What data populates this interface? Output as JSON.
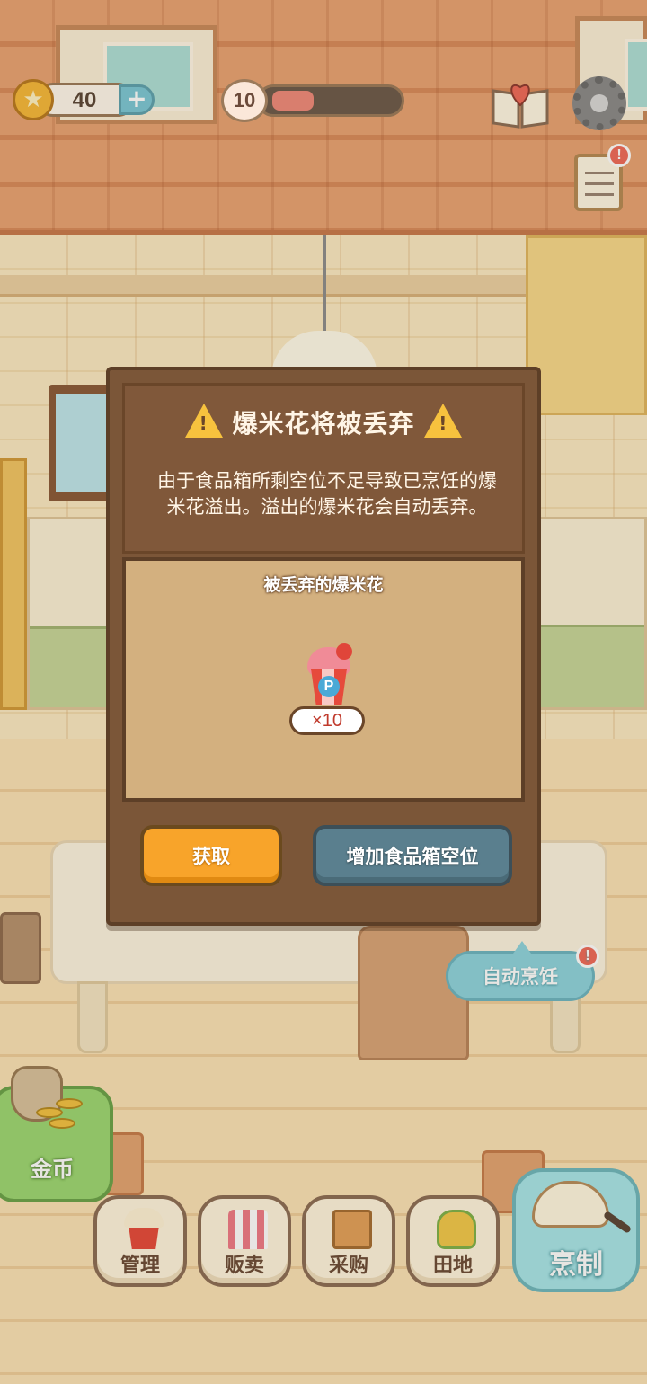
{
  "hud": {
    "coins": "40",
    "level": "10",
    "xp_progress": 0.28
  },
  "dialog": {
    "title": "爆米花将被丢弃",
    "warning_mark": "!",
    "description": "由于食品箱所剩空位不足导致已烹饪的爆米花溢出。溢出的爆米花会自动丢弃。",
    "discarded_label": "被丢弃的爆米花",
    "item": {
      "icon_letter": "P",
      "quantity": "×10"
    },
    "buttons": {
      "get": "获取",
      "expand": "增加食品箱空位"
    }
  },
  "auto_cook": {
    "label": "自动烹饪",
    "alert": "!"
  },
  "task_alert": "!",
  "bottom_nav": {
    "gold": "金币",
    "manage": "管理",
    "sell": "贩卖",
    "buy": "采购",
    "field": "田地",
    "cook": "烹制"
  },
  "colors": {
    "dialog_bg": "#7b5638",
    "get_button": "#f8a42a",
    "expand_button": "#5a7f8e",
    "auto_cook": "#8ed4de",
    "cook_button": "#a8e6ea"
  }
}
